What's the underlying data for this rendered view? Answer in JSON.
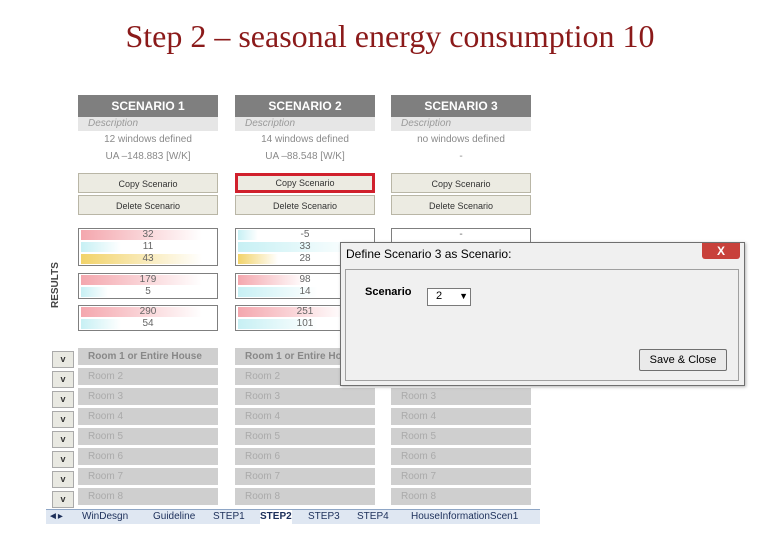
{
  "slide": {
    "title": "Step 2 – seasonal energy consumption 10"
  },
  "scenarios": [
    {
      "header": "SCENARIO 1",
      "desc_label": "Description",
      "windows": "12 windows defined",
      "ua": "UA –148.883 [W/K]",
      "copy": "Copy Scenario",
      "delete": "Delete Scenario",
      "results": [
        [
          {
            "v": "32",
            "c": "#f4a7ae",
            "f": 0.9
          },
          {
            "v": "11",
            "c": "#c7f0f4",
            "f": 0.3
          },
          {
            "v": "43",
            "c": "#f2d36a",
            "f": 0.9
          }
        ],
        [
          {
            "v": "179",
            "c": "#f4a7ae",
            "f": 0.9
          },
          {
            "v": "5",
            "c": "#c7f0f4",
            "f": 0.2
          }
        ],
        [
          {
            "v": "290",
            "c": "#f4a7ae",
            "f": 0.9
          },
          {
            "v": "54",
            "c": "#c7f0f4",
            "f": 0.3
          }
        ]
      ]
    },
    {
      "header": "SCENARIO 2",
      "desc_label": "Description",
      "windows": "14 windows defined",
      "ua": "UA –88.548 [W/K]",
      "copy": "Copy Scenario",
      "delete": "Delete Scenario",
      "results": [
        [
          {
            "v": "-5",
            "c": "#c7f0f4",
            "f": 0.15
          },
          {
            "v": "33",
            "c": "#c7f0f4",
            "f": 0.9
          },
          {
            "v": "28",
            "c": "#f2d36a",
            "f": 0.3
          }
        ],
        [
          {
            "v": "98",
            "c": "#f4a7ae",
            "f": 0.5
          },
          {
            "v": "14",
            "c": "#c7f0f4",
            "f": 0.6
          }
        ],
        [
          {
            "v": "251",
            "c": "#f4a7ae",
            "f": 0.8
          },
          {
            "v": "101",
            "c": "#c7f0f4",
            "f": 0.6
          }
        ]
      ]
    },
    {
      "header": "SCENARIO 3",
      "desc_label": "Description",
      "windows": "no windows defined",
      "ua": "-",
      "copy": "Copy Scenario",
      "delete": "Delete Scenario",
      "results": [
        [
          {
            "v": "-",
            "c": "#ffffff",
            "f": 0
          },
          {
            "v": "",
            "c": "#ffffff",
            "f": 0
          },
          {
            "v": "",
            "c": "#ffffff",
            "f": 0
          }
        ],
        [
          {
            "v": "",
            "c": "#ffffff",
            "f": 0
          },
          {
            "v": "",
            "c": "#ffffff",
            "f": 0
          }
        ],
        [
          {
            "v": "",
            "c": "#ffffff",
            "f": 0
          },
          {
            "v": "",
            "c": "#ffffff",
            "f": 0
          }
        ]
      ]
    }
  ],
  "results_label": "RESULTS",
  "rooms": [
    "Room 1 or Entire House",
    "Room 2",
    "Room 3",
    "Room 4",
    "Room 5",
    "Room 6",
    "Room 7",
    "Room 8"
  ],
  "rooms_s2": [
    "Room 1 or Entire Ho",
    "Room 2",
    "Room 3",
    "Room 4",
    "Room 5",
    "Room 6",
    "Room 7",
    "Room 8"
  ],
  "rooms_s3": [
    "",
    "",
    "Room 3",
    "Room 4",
    "Room 5",
    "Room 6",
    "Room 7",
    "Room 8"
  ],
  "expand_label": "v",
  "tabs": [
    "WinDesgn",
    "Guideline",
    "STEP1",
    "STEP2",
    "STEP3",
    "STEP4",
    "HouseInformationScen1"
  ],
  "active_tab": "STEP2",
  "tab_nav": "◄▸",
  "dialog": {
    "title": "Define Scenario 3 as Scenario:",
    "close": "X",
    "label": "Scenario",
    "value": "2",
    "caret": "▼",
    "save": "Save & Close"
  },
  "colors": {
    "title": "#8b1a1a",
    "highlight": "#d0202c",
    "header": "#7f7f7f"
  }
}
